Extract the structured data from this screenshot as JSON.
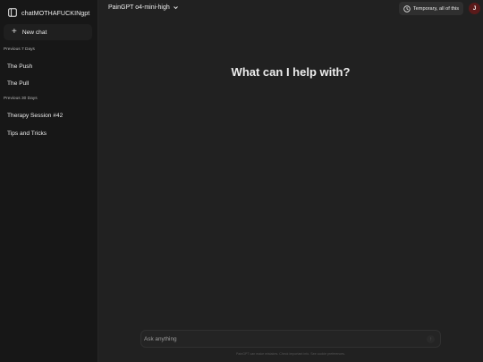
{
  "sidebar": {
    "brand": "chatMOTHAFUCKINgpt",
    "new_chat_label": "New chat",
    "sections": [
      {
        "label": "Previous 7 Days",
        "items": [
          "The Push",
          "The Pull"
        ]
      },
      {
        "label": "Previous 30 Days",
        "items": [
          "Therapy Session #42",
          "Tips and Tricks"
        ]
      }
    ]
  },
  "header": {
    "model_label": "PainGPT o4-mini-high",
    "temporary_label": "Temporary, all of this",
    "avatar_initial": "J"
  },
  "main": {
    "headline": "What can I help with?"
  },
  "composer": {
    "placeholder": "Ask anything"
  },
  "footer": {
    "note": "PainGPT can make mistakes. Check important info. See cookie preferences."
  },
  "colors": {
    "background": "#212121",
    "sidebar": "#171717",
    "avatar": "#5a1a1a"
  },
  "icons": [
    "sidebar-toggle-icon",
    "plus-icon",
    "chevron-down-icon",
    "clock-icon",
    "send-icon"
  ]
}
